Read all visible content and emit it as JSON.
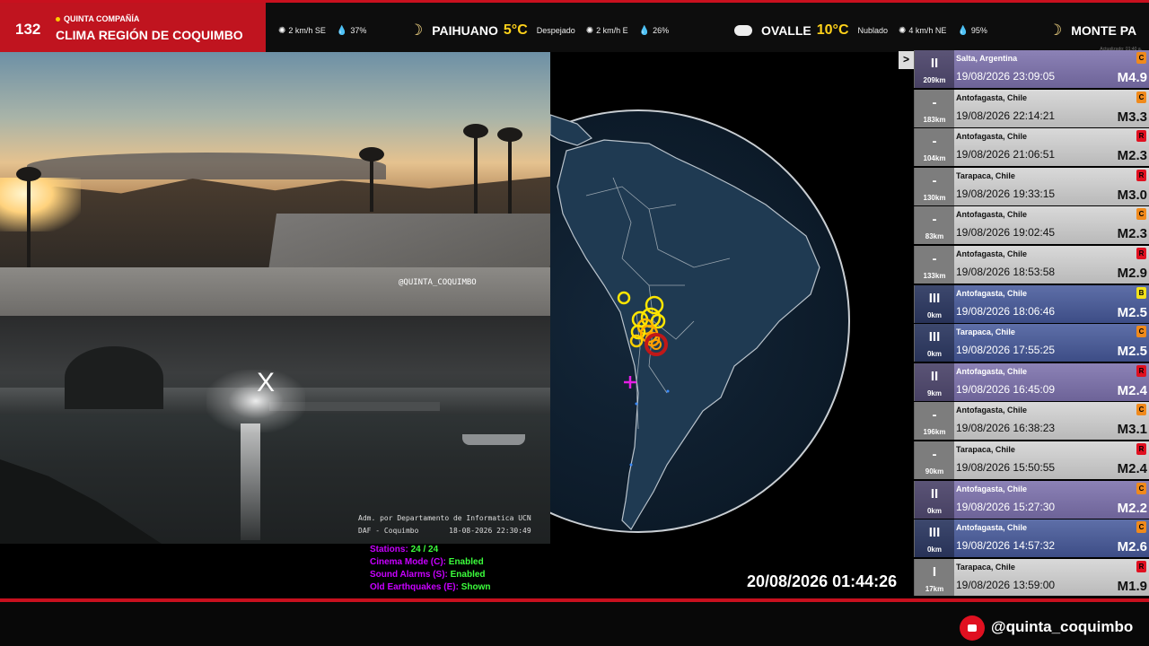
{
  "header": {
    "brand_number": "132",
    "brand_subtitle": "QUINTA COMPAÑÍA",
    "brand_title": "CLIMA REGIÓN DE COQUIMBO",
    "updated_label": "Actualizado: 01:40 a.",
    "ticker": {
      "prev_wind": "2 km/h SE",
      "prev_humidity": "37%",
      "city1": "PAIHUANO",
      "temp1": "5°C",
      "cond1": "Despejado",
      "wind1": "2 km/h E",
      "hum1": "26%",
      "city2": "OVALLE",
      "temp2": "10°C",
      "cond2": "Nublado",
      "wind2": "4 km/h NE",
      "hum2": "95%",
      "city3": "MONTE PA"
    }
  },
  "cameras": {
    "cam1_watermark": "@QUINTA_COQUIMBO",
    "cam2_close": "X",
    "cam2_credit_line1": "Adm. por Departamento de Informatica UCN",
    "cam2_credit_line2": "DAF - Coquimbo       18-08-2026 22:30:49"
  },
  "status": {
    "stations_label": "Stations:",
    "stations_value": "24 / 24",
    "cinema_label": "Cinema Mode (C):",
    "cinema_value": "Enabled",
    "sound_label": "Sound Alarms (S):",
    "sound_value": "Enabled",
    "old_label": "Old Earthquakes (E):",
    "old_value": "Shown"
  },
  "clock": "20/08/2026 01:44:26",
  "toggle_label": ">",
  "quakes": [
    {
      "intensity": "II",
      "dist": "209km",
      "place": "Salta, Argentina",
      "time": "19/08/2026 23:09:05",
      "mag": "M4.9",
      "badge": "C",
      "badge_color": "#f08a1c",
      "style": "purple"
    },
    {
      "intensity": "-",
      "dist": "183km",
      "place": "Antofagasta, Chile",
      "time": "19/08/2026 22:14:21",
      "mag": "M3.3",
      "badge": "C",
      "badge_color": "#f08a1c",
      "style": "grey"
    },
    {
      "intensity": "-",
      "dist": "104km",
      "place": "Antofagasta, Chile",
      "time": "19/08/2026 21:06:51",
      "mag": "M2.3",
      "badge": "R",
      "badge_color": "#e01020",
      "style": "grey"
    },
    {
      "intensity": "-",
      "dist": "130km",
      "place": "Tarapaca, Chile",
      "time": "19/08/2026 19:33:15",
      "mag": "M3.0",
      "badge": "R",
      "badge_color": "#e01020",
      "style": "grey"
    },
    {
      "intensity": "-",
      "dist": "83km",
      "place": "Antofagasta, Chile",
      "time": "19/08/2026 19:02:45",
      "mag": "M2.3",
      "badge": "C",
      "badge_color": "#f08a1c",
      "style": "grey"
    },
    {
      "intensity": "-",
      "dist": "133km",
      "place": "Antofagasta, Chile",
      "time": "19/08/2026 18:53:58",
      "mag": "M2.9",
      "badge": "R",
      "badge_color": "#e01020",
      "style": "grey"
    },
    {
      "intensity": "III",
      "dist": "0km",
      "place": "Antofagasta, Chile",
      "time": "19/08/2026 18:06:46",
      "mag": "M2.5",
      "badge": "B",
      "badge_color": "#f2e21a",
      "style": "blue"
    },
    {
      "intensity": "III",
      "dist": "0km",
      "place": "Tarapaca, Chile",
      "time": "19/08/2026 17:55:25",
      "mag": "M2.5",
      "badge": "C",
      "badge_color": "#f08a1c",
      "style": "blue"
    },
    {
      "intensity": "II",
      "dist": "9km",
      "place": "Antofagasta, Chile",
      "time": "19/08/2026 16:45:09",
      "mag": "M2.4",
      "badge": "R",
      "badge_color": "#e01020",
      "style": "purple"
    },
    {
      "intensity": "-",
      "dist": "196km",
      "place": "Antofagasta, Chile",
      "time": "19/08/2026 16:38:23",
      "mag": "M3.1",
      "badge": "C",
      "badge_color": "#f08a1c",
      "style": "grey"
    },
    {
      "intensity": "-",
      "dist": "90km",
      "place": "Tarapaca, Chile",
      "time": "19/08/2026 15:50:55",
      "mag": "M2.4",
      "badge": "R",
      "badge_color": "#e01020",
      "style": "grey"
    },
    {
      "intensity": "II",
      "dist": "0km",
      "place": "Antofagasta, Chile",
      "time": "19/08/2026 15:27:30",
      "mag": "M2.2",
      "badge": "C",
      "badge_color": "#f08a1c",
      "style": "purple"
    },
    {
      "intensity": "III",
      "dist": "0km",
      "place": "Antofagasta, Chile",
      "time": "19/08/2026 14:57:32",
      "mag": "M2.6",
      "badge": "C",
      "badge_color": "#f08a1c",
      "style": "blue"
    },
    {
      "intensity": "I",
      "dist": "17km",
      "place": "Tarapaca, Chile",
      "time": "19/08/2026 13:59:00",
      "mag": "M1.9",
      "badge": "R",
      "badge_color": "#e01020",
      "style": "grey"
    }
  ],
  "footer": {
    "handle": "@quinta_coquimbo"
  }
}
